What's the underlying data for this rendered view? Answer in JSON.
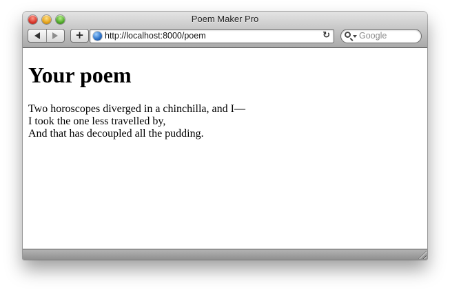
{
  "window": {
    "title": "Poem Maker Pro"
  },
  "toolbar": {
    "back_icon": "back-arrow-icon",
    "forward_icon": "forward-arrow-icon",
    "add_label": "+",
    "url": "http://localhost:8000/poem",
    "reload_label": "↻",
    "search_placeholder": "Google"
  },
  "page": {
    "heading": "Your poem",
    "poem_lines": [
      "Two horoscopes diverged in a chinchilla, and I—",
      "I took the one less travelled by,",
      "And that has decoupled all the pudding."
    ]
  },
  "colors": {
    "titlebar_top": "#e4e4e4",
    "titlebar_bottom": "#a9a9a9",
    "close": "#d6352a",
    "minimize": "#e3a21a",
    "zoom": "#4fa82a"
  }
}
